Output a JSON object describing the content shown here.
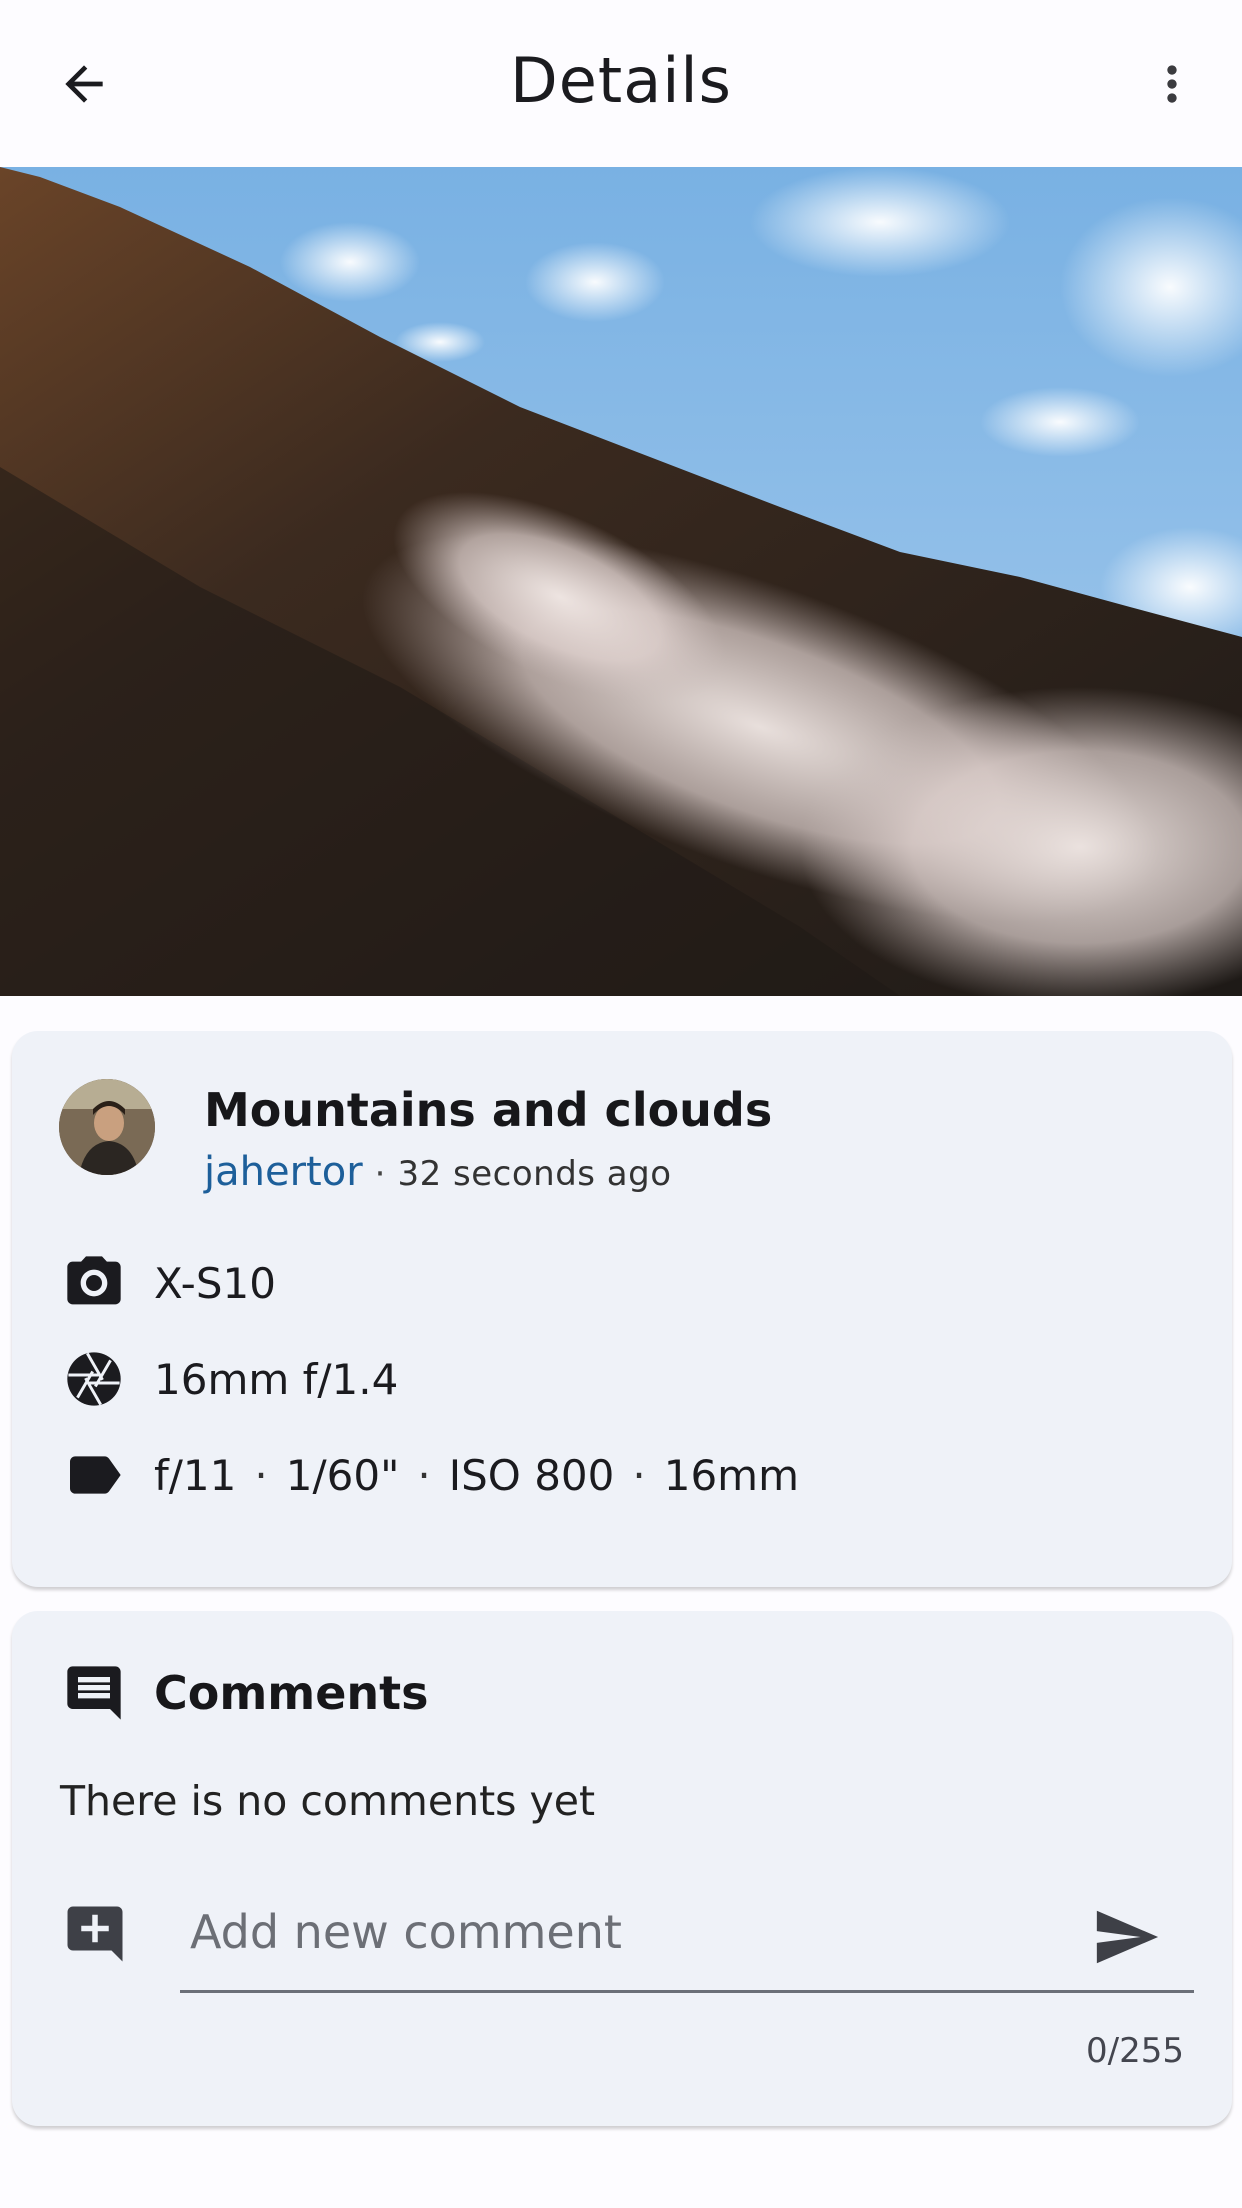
{
  "appbar": {
    "title": "Details",
    "back_icon": "arrow-back-icon",
    "more_icon": "more-vert-icon"
  },
  "photo": {
    "description_icon": "landscape-photo",
    "colors": {
      "sky": "#8dbde6",
      "forest": "#3a2a20",
      "mist": "#e9dfdc"
    }
  },
  "info": {
    "title": "Mountains and clouds",
    "author": "jahertor",
    "separator": "·",
    "time": "32 seconds ago",
    "camera": "X-S10",
    "lens": "16mm f/1.4",
    "settings": {
      "aperture": "f/11",
      "shutter": "1/60\"",
      "iso": "ISO 800",
      "focal": "16mm",
      "separator": "·"
    }
  },
  "comments": {
    "heading": "Comments",
    "empty_text": "There is no comments yet",
    "input_placeholder": "Add new comment",
    "input_value": "",
    "counter": "0/255"
  },
  "colors": {
    "background": "#fdfcff",
    "card": "#eff2f8",
    "author_link": "#1d5f9a",
    "icon": "#1b1b1f"
  }
}
